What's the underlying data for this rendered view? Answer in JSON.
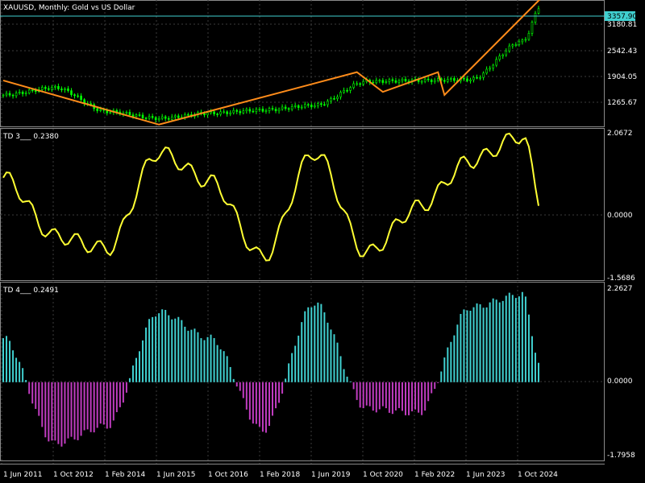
{
  "window": {
    "title": "XAUUSD, Monthly:  Gold vs US Dollar"
  },
  "price_panel": {
    "current_price_label": "3357.90",
    "y_labels": [
      "3180.81",
      "2542.43",
      "1904.05",
      "1265.67"
    ],
    "colors": {
      "candle": "#00ff00",
      "trendline": "#ff8c1a",
      "price_line": "#40d0d0",
      "price_tag_bg": "#40d0d0"
    }
  },
  "td3_panel": {
    "title": "TD 3___  0.2380",
    "y_labels": [
      "2.0672",
      "0.0000",
      "-1.5686"
    ],
    "color": "#ffff33"
  },
  "td4_panel": {
    "title": "TD 4___  0.2491",
    "y_labels": [
      "2.2627",
      "0.0000",
      "-1.7958"
    ],
    "colors": {
      "positive": "#40d0d0",
      "negative": "#c03cc0"
    }
  },
  "x_axis": {
    "labels": [
      "1 Jun 2011",
      "1 Oct 2012",
      "1 Feb 2014",
      "1 Jun 2015",
      "1 Oct 2016",
      "1 Feb 2018",
      "1 Jun 2019",
      "1 Oct 2020",
      "1 Feb 2022",
      "1 Jun 2023",
      "1 Oct 2024"
    ]
  },
  "chart_data": [
    {
      "type": "candlestick",
      "title": "XAUUSD, Monthly:  Gold vs US Dollar",
      "x": [
        "Jun 2011",
        "Oct 2012",
        "Feb 2014",
        "Jun 2015",
        "Oct 2016",
        "Feb 2018",
        "Jun 2019",
        "Oct 2020",
        "Feb 2022",
        "Jun 2023",
        "Oct 2024",
        "Apr 2025"
      ],
      "close": [
        1620,
        1760,
        1300,
        1170,
        1270,
        1330,
        1420,
        1880,
        1900,
        1920,
        2650,
        3357.9
      ],
      "ylim": [
        1000,
        3450
      ],
      "trendline_points": [
        [
          "Jun 2011",
          1900
        ],
        [
          "Jun 2015",
          1050
        ],
        [
          "Jul 2020",
          2060
        ],
        [
          "Mar 2021",
          1680
        ],
        [
          "Aug 2022",
          2060
        ],
        [
          "Oct 2022",
          1620
        ],
        [
          "Apr 2025",
          3500
        ]
      ]
    },
    {
      "type": "line",
      "title": "TD 3___  0.2380",
      "ylim": [
        -1.5686,
        2.0672
      ],
      "x": [
        "Jun 2011",
        "Oct 2012",
        "Feb 2014",
        "Jun 2015",
        "Oct 2016",
        "Feb 2018",
        "Jun 2019",
        "Oct 2020",
        "Feb 2022",
        "Jun 2023",
        "Oct 2024",
        "Apr 2025"
      ],
      "values": [
        0.9,
        -0.5,
        -0.8,
        1.5,
        0.8,
        -1.0,
        1.5,
        -0.9,
        0.2,
        1.3,
        1.9,
        0.238
      ]
    },
    {
      "type": "bar",
      "title": "TD 4___  0.2491",
      "ylim": [
        -1.7958,
        2.2627
      ],
      "x": [
        "Jun 2011",
        "Oct 2012",
        "Feb 2014",
        "Jun 2015",
        "Oct 2016",
        "Feb 2018",
        "Jun 2019",
        "Oct 2020",
        "Feb 2022",
        "Jun 2023",
        "Oct 2024",
        "Apr 2025"
      ],
      "values": [
        1.0,
        -1.4,
        -1.0,
        1.6,
        1.0,
        -1.1,
        1.8,
        -0.6,
        -0.7,
        1.7,
        2.0,
        0.249
      ]
    }
  ]
}
